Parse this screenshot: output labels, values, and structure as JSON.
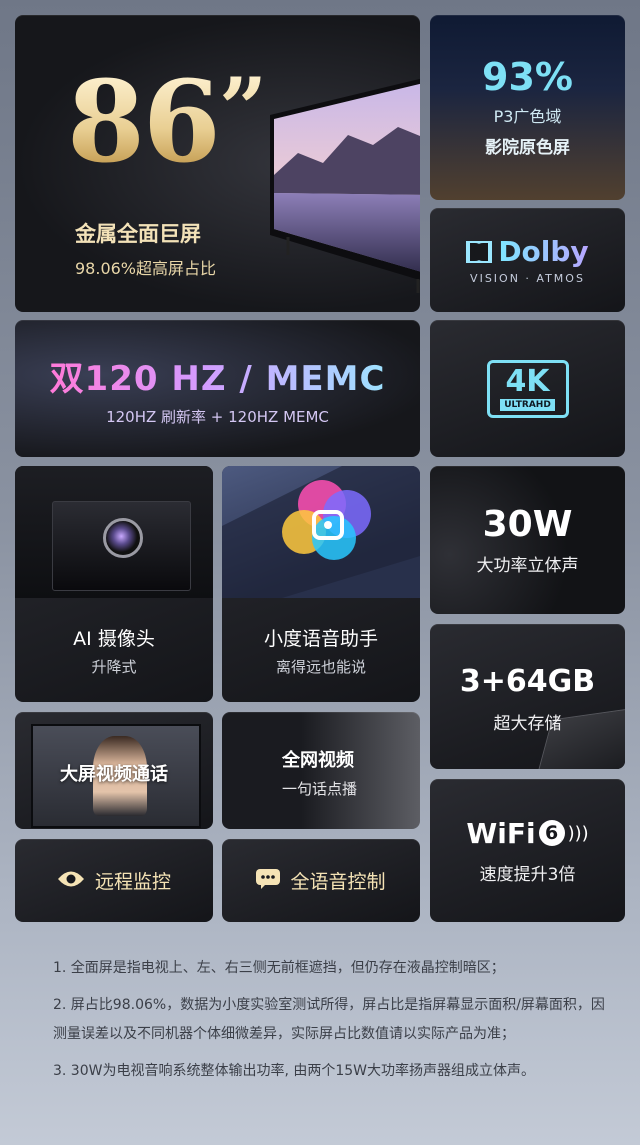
{
  "hero": {
    "size": "86",
    "inch_mark": "”",
    "title": "金属全面巨屏",
    "subtitle": "98.06%超高屏占比"
  },
  "p3": {
    "value": "93%",
    "line1": "P3广色域",
    "line2": "影院原色屏"
  },
  "dolby": {
    "name": "Dolby",
    "sub": "VISION · ATMOS"
  },
  "refresh": {
    "title": "双120 HZ / MEMC",
    "subtitle": "120HZ 刷新率 + 120HZ MEMC"
  },
  "uhd": {
    "big": "4K",
    "small": "ULTRAHD"
  },
  "camera": {
    "title": "AI 摄像头",
    "subtitle": "升降式"
  },
  "voice_assistant": {
    "title": "小度语音助手",
    "subtitle": "离得远也能说"
  },
  "audio": {
    "value": "30W",
    "subtitle": "大功率立体声"
  },
  "storage": {
    "value": "3+64GB",
    "subtitle": "超大存储"
  },
  "video_call": {
    "title": "大屏视频通话"
  },
  "video": {
    "title": "全网视频",
    "subtitle": "一句话点播"
  },
  "wifi": {
    "name": "WiFi",
    "version": "6",
    "subtitle": "速度提升3倍"
  },
  "monitor": {
    "label": "远程监控"
  },
  "voice_control": {
    "label": "全语音控制"
  },
  "notes": [
    "1. 全面屏是指电视上、左、右三侧无前框遮挡，但仍存在液晶控制暗区；",
    "2.    屏占比98.06%，数据为小度实验室测试所得，屏占比是指屏幕显示面积/屏幕面积，因测量误差以及不同机器个体细微差异，实际屏占比数值请以实际产品为准；",
    "3. 30W为电视音响系统整体输出功率, 由两个15W大功率扬声器组成立体声。"
  ],
  "colors": {
    "gold": "#e9cf93",
    "cyan": "#7ee0f5",
    "pink": "#ff7ad9"
  }
}
